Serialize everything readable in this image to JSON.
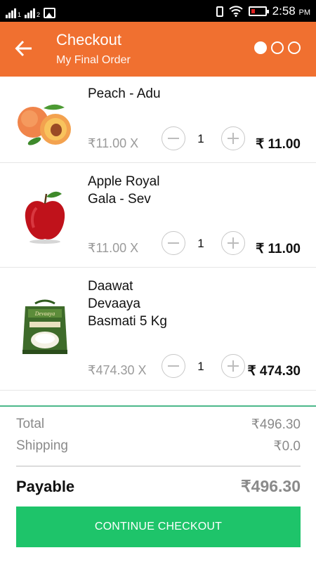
{
  "status_bar": {
    "time": "2:58",
    "ampm": "PM",
    "signal_labels": [
      "1",
      "2"
    ],
    "icons": [
      "signal-icon",
      "signal-icon",
      "gallery-icon",
      "vibrate-icon",
      "wifi-icon",
      "battery-icon"
    ],
    "battery_color": "#e02020"
  },
  "header": {
    "title": "Checkout",
    "subtitle": "My Final Order",
    "back_icon": "arrow-left-icon",
    "step_count": 3,
    "current_step": 1,
    "background": "#f07030"
  },
  "cart": {
    "items": [
      {
        "name": "Peach - Adu",
        "unit_price": "₹11.00 X",
        "quantity": "1",
        "total": "₹ 11.00",
        "image": "peach-image"
      },
      {
        "name": "Apple Royal Gala - Sev",
        "unit_price": "₹11.00 X",
        "quantity": "1",
        "total": "₹ 11.00",
        "image": "apple-image"
      },
      {
        "name": "Daawat Devaaya Basmati 5 Kg",
        "unit_price": "₹474.30 X",
        "quantity": "1",
        "total": "₹ 474.30",
        "image": "rice-bag-image"
      }
    ],
    "decrement_icon": "minus-circle-icon",
    "increment_icon": "plus-circle-icon"
  },
  "summary": {
    "total_label": "Total",
    "total_value": "₹496.30",
    "shipping_label": "Shipping",
    "shipping_value": "₹0.0",
    "payable_label": "Payable",
    "payable_value": "₹496.30",
    "accent_line_color": "#4cb88a"
  },
  "cta": {
    "label": "CONTINUE CHECKOUT",
    "color": "#1ec46a"
  }
}
